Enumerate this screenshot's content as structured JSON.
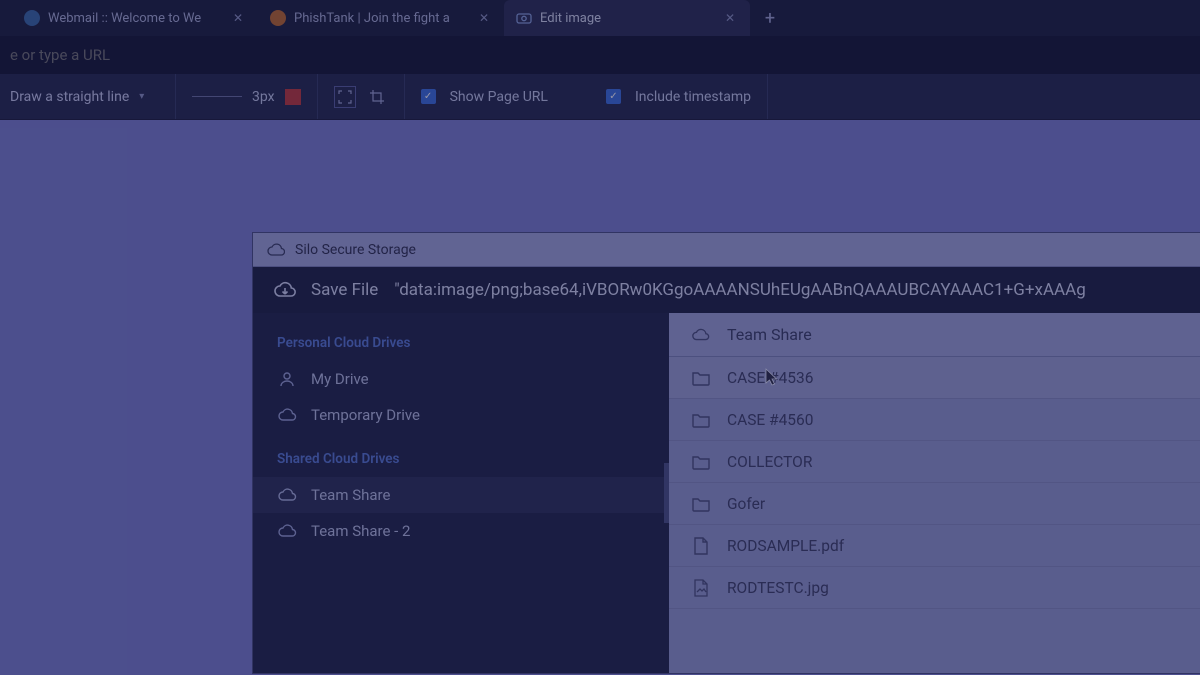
{
  "browser": {
    "tabs": [
      {
        "title": "Webmail :: Welcome to We",
        "favicon_color": "#5aa6e0"
      },
      {
        "title": "PhishTank | Join the fight a",
        "favicon_color": "#e08a3a"
      },
      {
        "title": "Edit image",
        "favicon_color": "#5a8ae0",
        "active": true
      }
    ],
    "url_placeholder": "e or type a URL"
  },
  "toolbar": {
    "line_tool": "Draw a straight line",
    "stroke_width": "3px",
    "show_page_url_label": "Show Page URL",
    "include_timestamp_label": "Include timestamp",
    "show_page_url_checked": true,
    "include_timestamp_checked": true
  },
  "storage_window": {
    "title": "Silo Secure Storage",
    "save_label": "Save File",
    "save_filename": "\"data:image/png;base64,iVBORw0KGgoAAAANSUhEUgAABnQAAAUBCAYAAAC1+G+xAAAg",
    "sidebar": {
      "personal_head": "Personal Cloud Drives",
      "shared_head": "Shared Cloud Drives",
      "personal": [
        {
          "label": "My Drive",
          "icon": "person"
        },
        {
          "label": "Temporary Drive",
          "icon": "cloud"
        }
      ],
      "shared": [
        {
          "label": "Team Share",
          "icon": "cloud",
          "selected": true
        },
        {
          "label": "Team Share - 2",
          "icon": "cloud"
        }
      ]
    },
    "path": {
      "label": "Team Share"
    },
    "files": [
      {
        "name": "CASE #4536",
        "type": "folder",
        "cursor": true
      },
      {
        "name": "CASE #4560",
        "type": "folder"
      },
      {
        "name": "COLLECTOR",
        "type": "folder"
      },
      {
        "name": "Gofer",
        "type": "folder"
      },
      {
        "name": "RODSAMPLE.pdf",
        "type": "file"
      },
      {
        "name": "RODTESTC.jpg",
        "type": "image"
      }
    ]
  }
}
